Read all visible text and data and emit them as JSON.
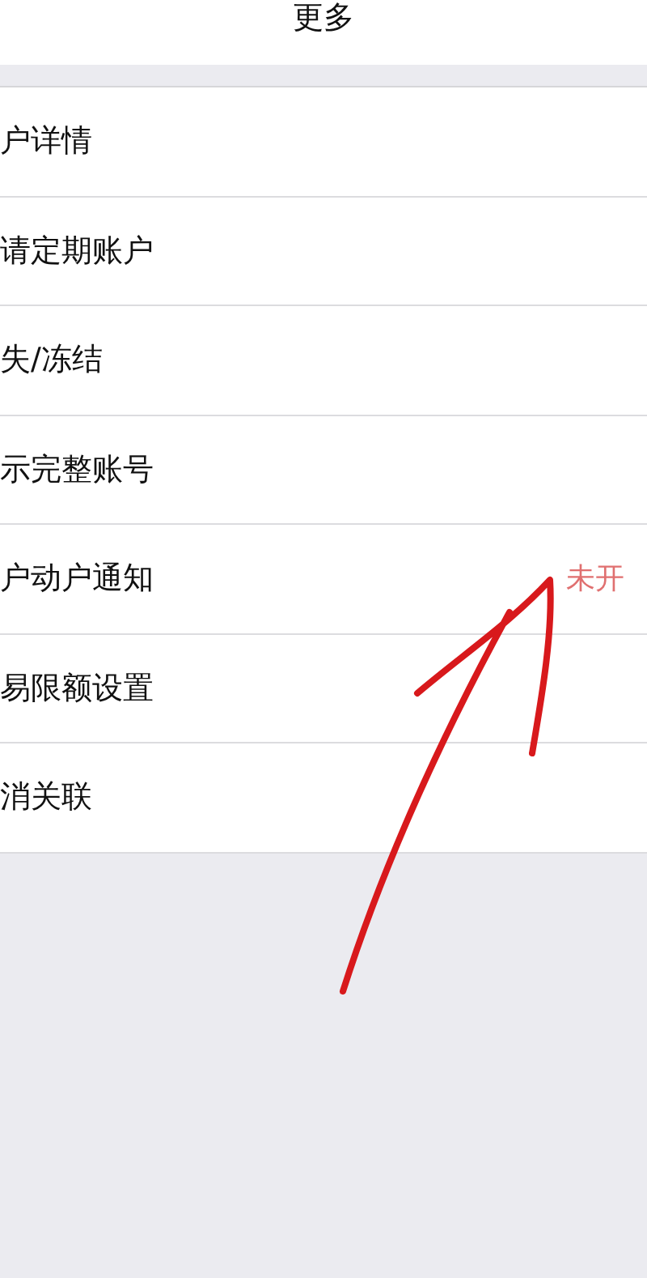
{
  "header": {
    "title": "更多"
  },
  "menu": [
    {
      "label": "户详情"
    },
    {
      "label": "请定期账户"
    },
    {
      "label": "失/冻结"
    },
    {
      "label": "示完整账号"
    },
    {
      "label": "户动户通知",
      "status": "未开"
    },
    {
      "label": "易限额设置"
    },
    {
      "label": "消关联"
    }
  ]
}
